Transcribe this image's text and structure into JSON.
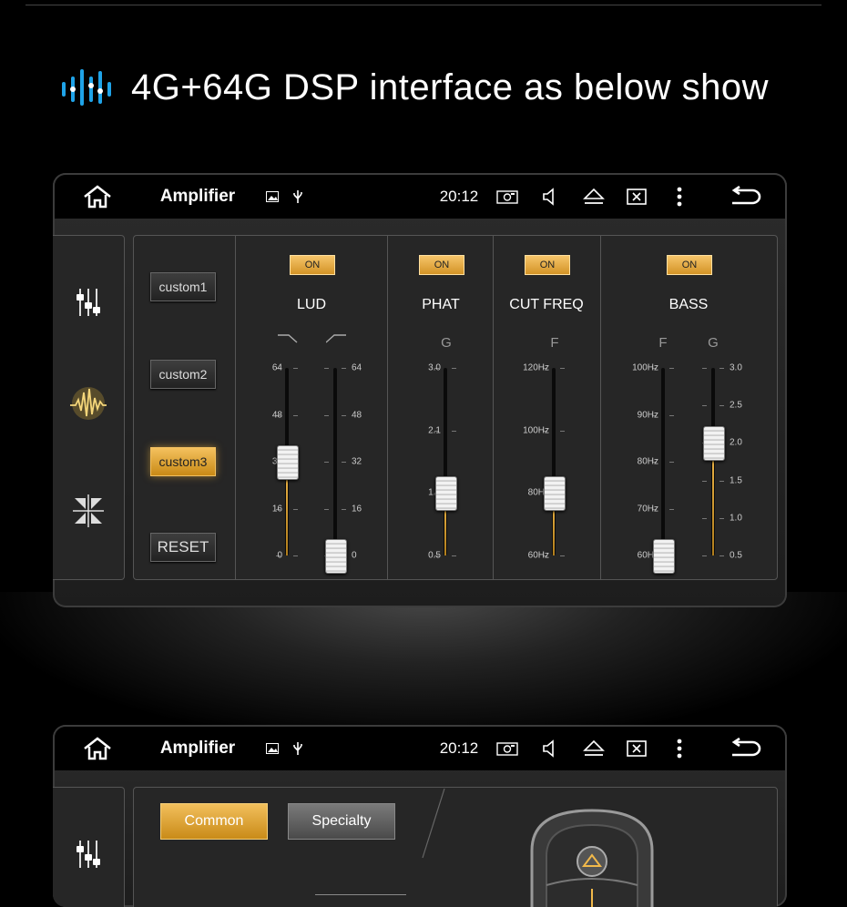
{
  "headline": {
    "text": "4G+64G DSP interface as below show",
    "icon": "audio-wave-icon"
  },
  "screens": [
    {
      "statusbar": {
        "title": "Amplifier",
        "time": "20:12",
        "icons": [
          "home-icon",
          "image-icon",
          "usb-icon",
          "screenshot-icon",
          "volume-icon",
          "eject-icon",
          "close-box-icon",
          "more-icon",
          "back-icon"
        ]
      },
      "sidebar": [
        "equalizer-icon",
        "sound-wave-icon",
        "balance-icon"
      ],
      "presets": {
        "custom1": "custom1",
        "custom2": "custom2",
        "custom3": "custom3",
        "reset": "RESET",
        "active": "custom3"
      },
      "sections": {
        "lud": {
          "on": "ON",
          "label": "LUD"
        },
        "phat": {
          "on": "ON",
          "label": "PHAT",
          "sub": "G"
        },
        "cut_freq": {
          "on": "ON",
          "label": "CUT FREQ",
          "sub": "F"
        },
        "bass": {
          "on": "ON",
          "label": "BASS",
          "sub_f": "F",
          "sub_g": "G"
        }
      },
      "sliders": [
        {
          "id": "lud-low",
          "ticks": [
            "64",
            "48",
            "32",
            "16",
            "0"
          ],
          "value": 32,
          "label_side": "left"
        },
        {
          "id": "lud-high",
          "ticks": [
            "64",
            "48",
            "32",
            "16",
            "0"
          ],
          "value": 0,
          "label_side": "right"
        },
        {
          "id": "phat-g",
          "ticks": [
            "3.0",
            "2.1",
            "1.3",
            "0.5"
          ],
          "value": 1.3,
          "label_side": "left"
        },
        {
          "id": "cut-freq-f",
          "ticks": [
            "120Hz",
            "100Hz",
            "80Hz",
            "60Hz"
          ],
          "value": "80Hz",
          "label_side": "left"
        },
        {
          "id": "bass-f",
          "ticks": [
            "100Hz",
            "90Hz",
            "80Hz",
            "70Hz",
            "60Hz"
          ],
          "value": "60Hz",
          "label_side": "left"
        },
        {
          "id": "bass-g",
          "ticks": [
            "3.0",
            "2.5",
            "2.0",
            "1.5",
            "1.0",
            "0.5"
          ],
          "value": 2.0,
          "label_side": "right"
        }
      ],
      "colors": {
        "accent": "#f2b94a",
        "background": "#262626"
      }
    },
    {
      "statusbar": {
        "title": "Amplifier",
        "time": "20:12"
      },
      "tabs": {
        "common": "Common",
        "specialty": "Specialty",
        "active": "common"
      }
    }
  ]
}
